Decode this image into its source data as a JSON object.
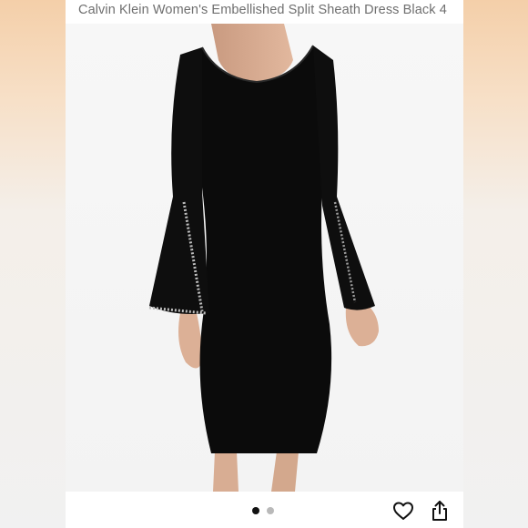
{
  "listing": {
    "title": "Calvin Klein Women's Embellished Split Sheath Dress Black 4"
  },
  "image": {
    "subject": "black-sheath-dress",
    "carousel_count": 2,
    "active_index": 1
  },
  "actions": {
    "like_icon": "heart-icon",
    "share_icon": "share-icon"
  },
  "colors": {
    "background_top": "#f4cfa9",
    "frame": "#ffffff",
    "dot_active": "#111111",
    "dot_inactive": "#b9b9b9"
  }
}
